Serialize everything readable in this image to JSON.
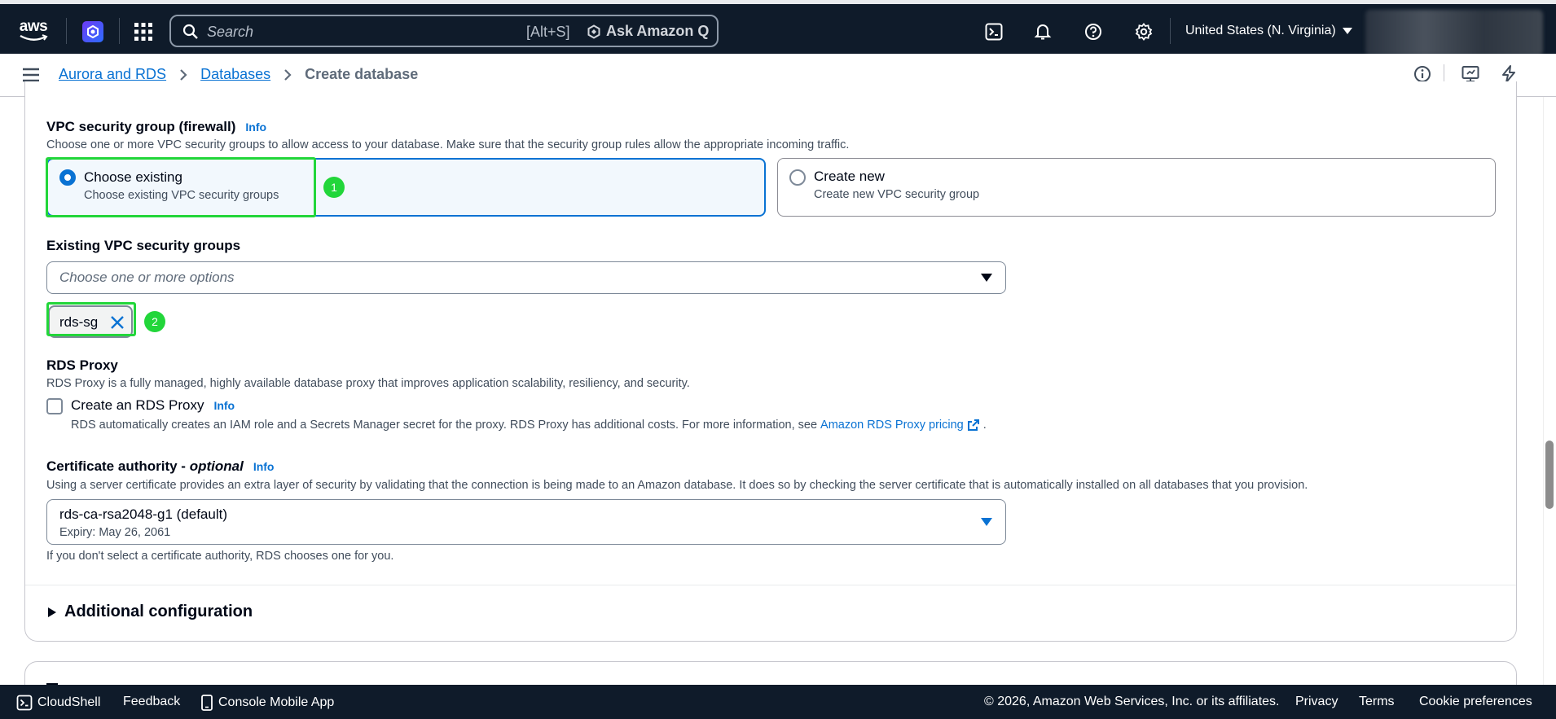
{
  "topnav": {
    "logo_text": "aws",
    "search_placeholder": "Search",
    "search_shortcut": "[Alt+S]",
    "ask_q_label": "Ask Amazon Q",
    "region": "United States (N. Virginia)"
  },
  "breadcrumb": {
    "items": [
      "Aurora and RDS",
      "Databases"
    ],
    "current": "Create database"
  },
  "vpc": {
    "title": "VPC security group (firewall)",
    "info": "Info",
    "description": "Choose one or more VPC security groups to allow access to your database. Make sure that the security group rules allow the appropriate incoming traffic.",
    "options": [
      {
        "title": "Choose existing",
        "sub": "Choose existing VPC security groups",
        "selected": true
      },
      {
        "title": "Create new",
        "sub": "Create new VPC security group",
        "selected": false
      }
    ]
  },
  "existing_groups": {
    "label": "Existing VPC security groups",
    "placeholder": "Choose one or more options",
    "tokens": [
      "rds-sg"
    ]
  },
  "annotations": [
    "1",
    "2"
  ],
  "rds_proxy": {
    "title": "RDS Proxy",
    "description": "RDS Proxy is a fully managed, highly available database proxy that improves application scalability, resiliency, and security.",
    "checkbox_label": "Create an RDS Proxy",
    "info": "Info",
    "checked": false,
    "note": "RDS automatically creates an IAM role and a Secrets Manager secret for the proxy. RDS Proxy has additional costs. For more information, see",
    "note_link": "Amazon RDS Proxy pricing",
    "note_end": "."
  },
  "certificate": {
    "title": "Certificate authority -",
    "title_optional": "optional",
    "info": "Info",
    "description": "Using a server certificate provides an extra layer of security by validating that the connection is being made to an Amazon database. It does so by checking the server certificate that is automatically installed on all databases that you provision.",
    "value": "rds-ca-rsa2048-g1 (default)",
    "expiry": "Expiry: May 26, 2061",
    "hint": "If you don't select a certificate authority, RDS chooses one for you."
  },
  "additional_configuration": "Additional configuration",
  "footer": {
    "cloudshell": "CloudShell",
    "feedback": "Feedback",
    "mobile_app": "Console Mobile App",
    "copyright": "© 2026, Amazon Web Services, Inc. or its affiliates.",
    "privacy": "Privacy",
    "terms": "Terms",
    "cookies": "Cookie preferences"
  },
  "colors": {
    "nav_bg": "#0f1b2a",
    "link_blue": "#0972d3",
    "highlight_green": "#22d63a"
  }
}
